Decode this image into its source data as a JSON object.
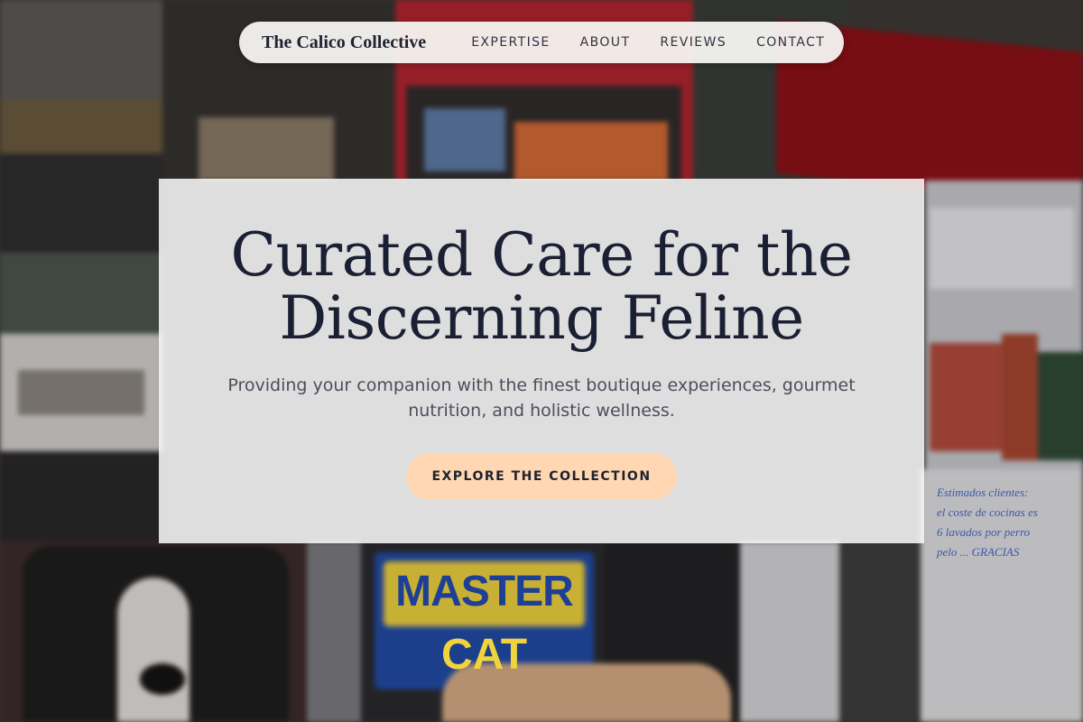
{
  "nav": {
    "brand": "The Calico Collective",
    "items": [
      {
        "label": "EXPERTISE"
      },
      {
        "label": "ABOUT"
      },
      {
        "label": "REVIEWS"
      },
      {
        "label": "CONTACT"
      }
    ]
  },
  "hero": {
    "title": "Curated Care for the Discerning Feline",
    "subtitle": "Providing your companion with the finest boutique experiences, gourmet nutrition, and holistic wellness.",
    "cta_label": "EXPLORE THE COLLECTION"
  },
  "background": {
    "sign_line1": "MASTER",
    "sign_line2": "CAT",
    "note_lines": [
      "Estimados clientes:",
      "el coste de cocinas es",
      "6 lavados por perro",
      "pelo ... GRACIAS"
    ]
  },
  "colors": {
    "cta_bg": "#ffd7b2",
    "title": "#1a1f33",
    "nav_bg": "#f8f6f3"
  }
}
